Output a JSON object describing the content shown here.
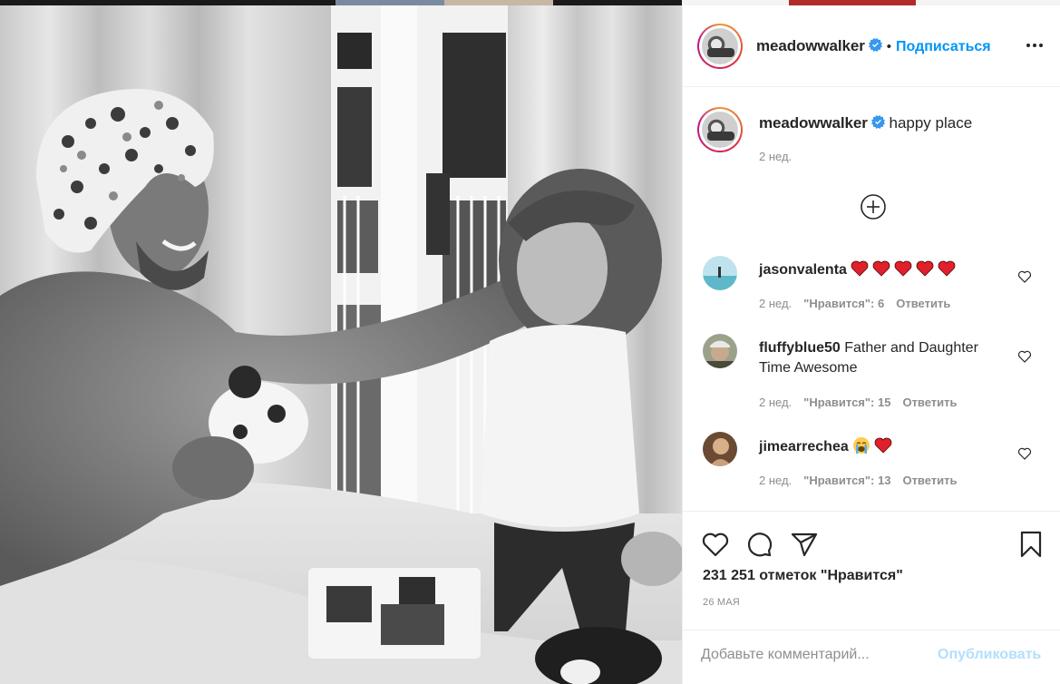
{
  "header": {
    "username": "meadowwalker",
    "separator": "•",
    "follow_label": "Подписаться"
  },
  "caption": {
    "username": "meadowwalker",
    "text": "happy place",
    "time": "2 нед."
  },
  "comments": [
    {
      "username": "jasonvalenta",
      "text": "",
      "emoji": [
        "red-heart",
        "red-heart",
        "red-heart",
        "red-heart",
        "red-heart"
      ],
      "time": "2 нед.",
      "likes": "\"Нравится\": 6",
      "reply": "Ответить"
    },
    {
      "username": "fluffyblue50",
      "text": "Father and Daughter Time Awesome",
      "emoji": [],
      "time": "2 нед.",
      "likes": "\"Нравится\": 15",
      "reply": "Ответить"
    },
    {
      "username": "jimearrechea",
      "text": "",
      "emoji": [
        "loudly-crying-face",
        "red-heart"
      ],
      "time": "2 нед.",
      "likes": "\"Нравится\": 13",
      "reply": "Ответить"
    }
  ],
  "actions": {
    "icons": [
      "heart-icon",
      "comment-icon",
      "share-icon",
      "bookmark-icon"
    ],
    "likes": "231 251 отметок \"Нравится\"",
    "date": "26 МАЯ"
  },
  "add_comment": {
    "placeholder": "Добавьте комментарий...",
    "publish_label": "Опубликовать"
  },
  "colors": {
    "link": "#0095f6",
    "publish_disabled": "#b2dffc",
    "muted": "#8e8e8e",
    "text": "#262626",
    "heart": "#ed4956"
  }
}
